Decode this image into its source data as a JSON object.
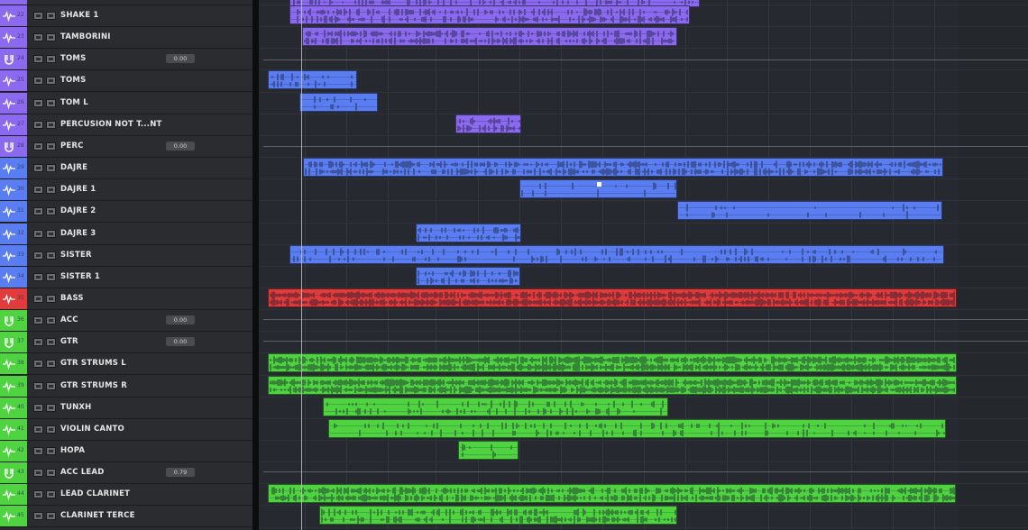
{
  "colors": {
    "purple": "#8b6af0",
    "blue": "#5a7ef2",
    "red": "#e23b3b",
    "green": "#4fd341"
  },
  "tracks": [
    {
      "num": "22",
      "name": "SHAKE 1",
      "color": "purple",
      "icon": "audio-track-icon"
    },
    {
      "num": "23",
      "name": "TAMBORINI",
      "color": "purple",
      "icon": "audio-track-icon"
    },
    {
      "num": "24",
      "name": "TOMS",
      "color": "purple",
      "icon": "folder-track-icon",
      "vol": "0.00"
    },
    {
      "num": "25",
      "name": "TOMS",
      "color": "purple",
      "icon": "audio-track-icon"
    },
    {
      "num": "26",
      "name": "TOM L",
      "color": "purple",
      "icon": "audio-track-icon"
    },
    {
      "num": "27",
      "name": "PERCUSION NOT T...NT",
      "color": "purple",
      "icon": "audio-track-icon"
    },
    {
      "num": "28",
      "name": "PERC",
      "color": "purple",
      "icon": "folder-track-icon",
      "vol": "0.00"
    },
    {
      "num": "29",
      "name": "DAJRE",
      "color": "blue",
      "icon": "audio-track-icon"
    },
    {
      "num": "30",
      "name": "DAJRE 1",
      "color": "blue",
      "icon": "audio-track-icon"
    },
    {
      "num": "31",
      "name": "DAJRE 2",
      "color": "blue",
      "icon": "audio-track-icon"
    },
    {
      "num": "32",
      "name": "DAJRE 3",
      "color": "blue",
      "icon": "audio-track-icon"
    },
    {
      "num": "33",
      "name": "SISTER",
      "color": "blue",
      "icon": "audio-track-icon"
    },
    {
      "num": "34",
      "name": "SISTER 1",
      "color": "blue",
      "icon": "audio-track-icon"
    },
    {
      "num": "35",
      "name": "BASS",
      "color": "red",
      "icon": "audio-track-icon"
    },
    {
      "num": "36",
      "name": "ACC",
      "color": "green",
      "icon": "folder-track-icon",
      "vol": "0.00"
    },
    {
      "num": "37",
      "name": "GTR",
      "color": "green",
      "icon": "folder-track-icon",
      "vol": "0.00"
    },
    {
      "num": "38",
      "name": "GTR STRUMS  L",
      "color": "green",
      "icon": "audio-track-icon"
    },
    {
      "num": "39",
      "name": "GTR STRUMS R",
      "color": "green",
      "icon": "audio-track-icon"
    },
    {
      "num": "40",
      "name": "TUNXH",
      "color": "green",
      "icon": "audio-track-icon"
    },
    {
      "num": "41",
      "name": "VIOLIN CANTO",
      "color": "green",
      "icon": "audio-track-icon"
    },
    {
      "num": "42",
      "name": "HOPA",
      "color": "green",
      "icon": "audio-track-icon"
    },
    {
      "num": "43",
      "name": "ACC LEAD",
      "color": "green",
      "icon": "folder-track-icon",
      "vol": "0.79"
    },
    {
      "num": "44",
      "name": "LEAD CLARINET",
      "color": "green",
      "icon": "audio-track-icon"
    },
    {
      "num": "45",
      "name": "CLARINET TERCE",
      "color": "green",
      "icon": "audio-track-icon"
    }
  ]
}
